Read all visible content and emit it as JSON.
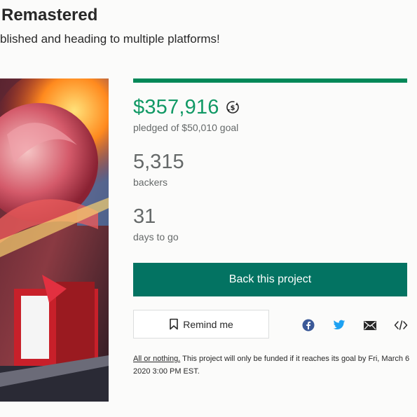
{
  "project": {
    "title": "Remastered",
    "blurb": "blished and heading to multiple platforms!"
  },
  "funding": {
    "progress_fraction": 1.0,
    "pledged": "$357,916",
    "currency_icon": "currency-conversion-icon",
    "pledged_label": "pledged of $50,010 goal",
    "backers": "5,315",
    "backers_label": "backers",
    "days": "31",
    "days_label": "days to go"
  },
  "actions": {
    "back_label": "Back this project",
    "remind_label": "Remind me",
    "remind_icon": "bookmark-icon",
    "share_icons": [
      "facebook-icon",
      "twitter-icon",
      "email-icon",
      "embed-icon"
    ]
  },
  "footnote": {
    "link": "All or nothing.",
    "text": " This project will only be funded if it reaches its goal by Fri, March 6 2020 3:00 PM EST."
  },
  "colors": {
    "accent_green": "#119965",
    "button_green": "#037362",
    "muted_text": "#656969",
    "facebook": "#3b5998",
    "twitter": "#1da1f2"
  }
}
